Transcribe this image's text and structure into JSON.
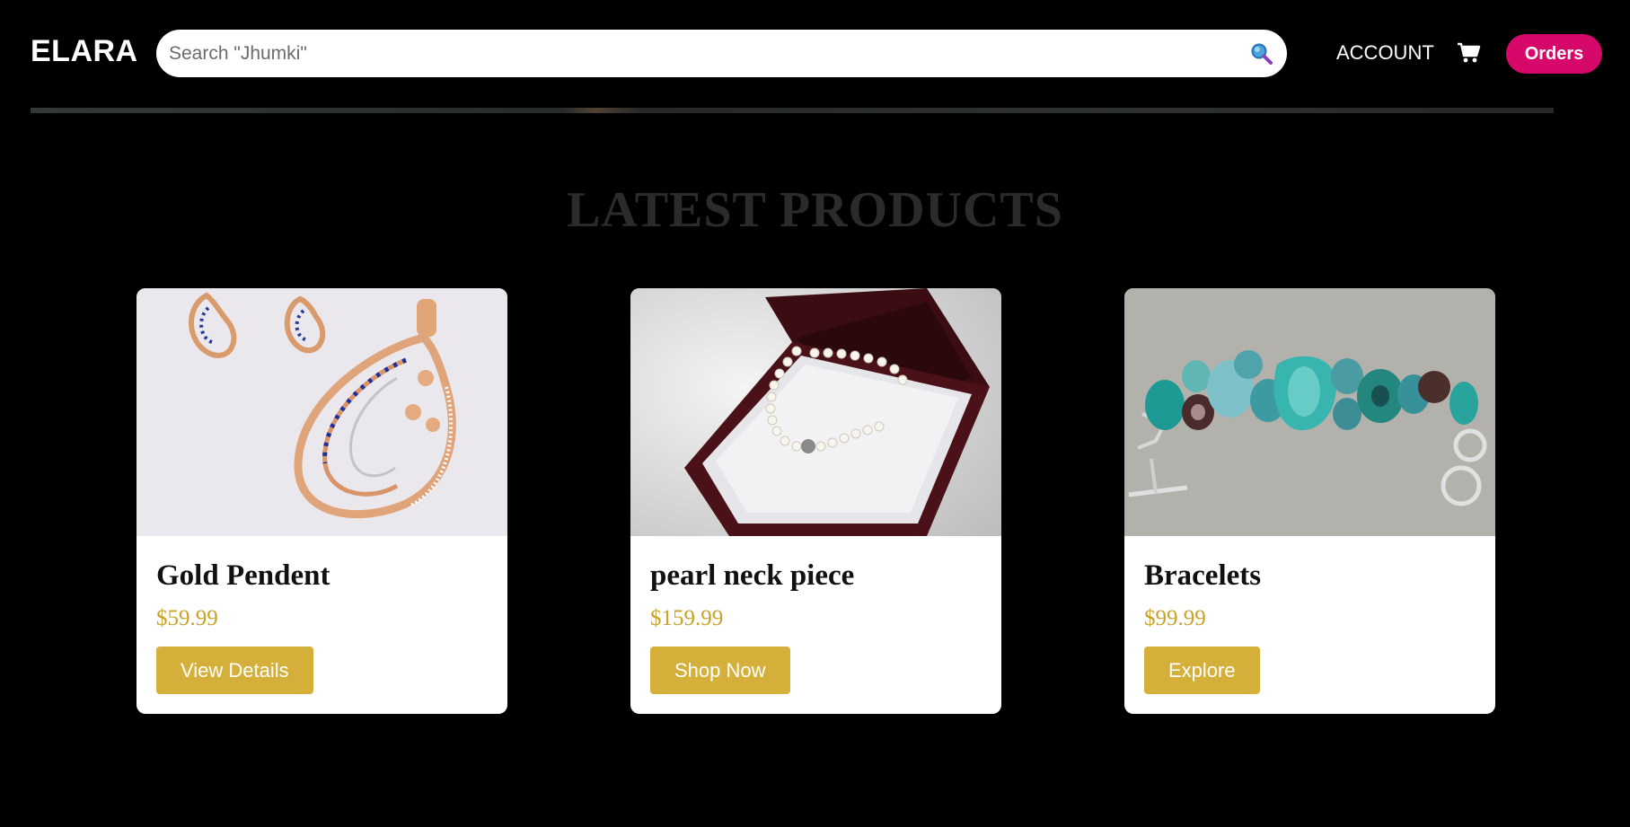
{
  "header": {
    "logo": "ELARA",
    "search": {
      "placeholder": "Search \"Jhumki\"",
      "icon": "search-icon"
    },
    "account_label": "ACCOUNT",
    "cart_icon": "cart-icon",
    "orders_label": "Orders"
  },
  "colors": {
    "background": "#000000",
    "orders_button": "#d6096a",
    "price": "#c9a227",
    "card_button": "#d4b03a",
    "section_title": "#2b2b2b"
  },
  "section": {
    "title": "LATEST PRODUCTS"
  },
  "products": [
    {
      "name": "Gold Pendent",
      "price": "$59.99",
      "button": "View Details",
      "image": "gold-pendant-image"
    },
    {
      "name": "pearl neck piece",
      "price": "$159.99",
      "button": "Shop Now",
      "image": "pearl-necklace-image"
    },
    {
      "name": "Bracelets",
      "price": "$99.99",
      "button": "Explore",
      "image": "gemstone-bracelet-image"
    }
  ]
}
